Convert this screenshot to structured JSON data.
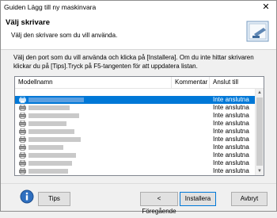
{
  "window": {
    "title": "Guiden Lägg till ny maskinvara",
    "close_glyph": "✕"
  },
  "header": {
    "title": "Välj skrivare",
    "subtitle": "Välj den skrivare som du vill använda."
  },
  "instruction": "Välj den port som du vill använda och klicka på [Installera]. Om du inte hittar skrivaren klickar du på [Tips].Tryck på F5-tangenten för att uppdatera listan.",
  "list": {
    "columns": {
      "name": "Modellnamn",
      "comment": "Kommentar",
      "port": "Anslut till"
    },
    "rows": [
      {
        "status": "Inte anslutna",
        "selected": true
      },
      {
        "status": "Inte anslutna"
      },
      {
        "status": "Inte anslutna"
      },
      {
        "status": "Inte anslutna"
      },
      {
        "status": "Inte anslutna"
      },
      {
        "status": "Inte anslutna"
      },
      {
        "status": "Inte anslutna"
      },
      {
        "status": "Inte anslutna"
      },
      {
        "status": "Inte anslutna"
      },
      {
        "status": "Inte anslutna"
      }
    ]
  },
  "buttons": {
    "tips": "Tips",
    "back": "< Föregående",
    "install": "Installera",
    "cancel": "Avbryt"
  },
  "icons": {
    "help": "help-info-icon",
    "printer": "printer-icon",
    "wizard": "wizard-printer-icon"
  },
  "colors": {
    "selection": "#0078d7"
  }
}
